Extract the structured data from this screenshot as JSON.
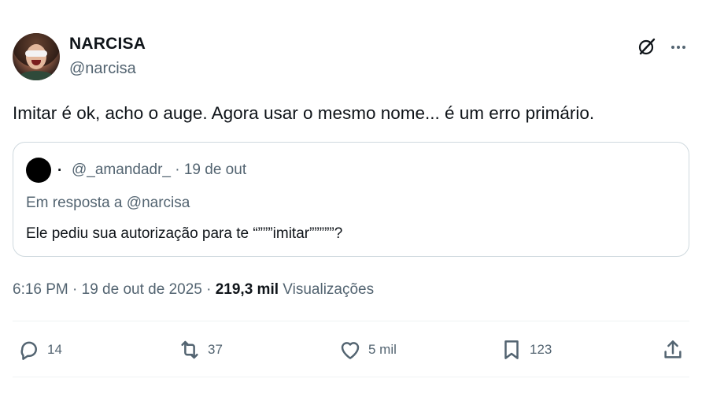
{
  "author": {
    "name": "NARCISA",
    "handle": "@narcisa",
    "avatar_icon": "profile-photo"
  },
  "tweet": {
    "text": "Imitar é ok, acho o auge. Agora usar o mesmo nome... é um erro primário."
  },
  "quoted": {
    "separator": ".",
    "meta": "@_amandadr_ · 19 de out",
    "reply_to": "Em resposta a @narcisa",
    "text": "Ele pediu sua autorização para te “”””imitar”””””?"
  },
  "meta": {
    "time_date": "6:16 PM · 19 de out de 2025 · ",
    "views_count": "219,3 mil",
    "views_label": " Visualizações"
  },
  "actions": {
    "replies": "14",
    "reposts": "37",
    "likes": "5 mil",
    "bookmarks": "123"
  },
  "icons": {
    "grok": "grok-icon",
    "more": "more-icon",
    "reply": "reply-icon",
    "repost": "repost-icon",
    "like": "heart-icon",
    "bookmark": "bookmark-icon",
    "share": "share-icon"
  },
  "colors": {
    "text": "#0f1419",
    "secondary": "#536471",
    "border": "#cfd9de"
  }
}
